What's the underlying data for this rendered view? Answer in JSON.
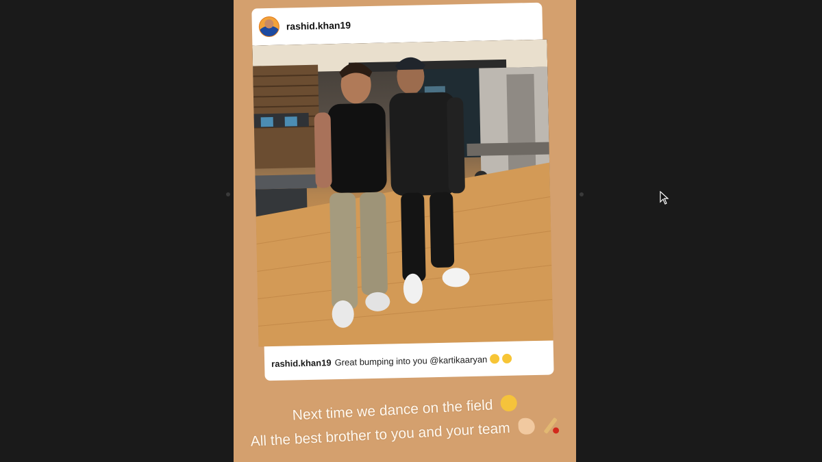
{
  "post": {
    "username": "rashid.khan19",
    "caption_user": "rashid.khan19",
    "caption_text": "Great bumping into you @kartikaaryan"
  },
  "story": {
    "line1": "Next time we dance on the field",
    "line2": "All the best brother to you and your team"
  },
  "icons": {
    "avatar": "profile-avatar",
    "caption_emojis": [
      "grinning-face-icon",
      "hugging-face-icon"
    ],
    "line1_emoji": "winking-face-tongue-icon",
    "line2_emojis": [
      "flexed-biceps-icon",
      "cricket-icon"
    ],
    "cursor": "mouse-pointer-icon"
  },
  "colors": {
    "story_background": "#d4a06e",
    "viewer_background": "#1a1a1a"
  }
}
